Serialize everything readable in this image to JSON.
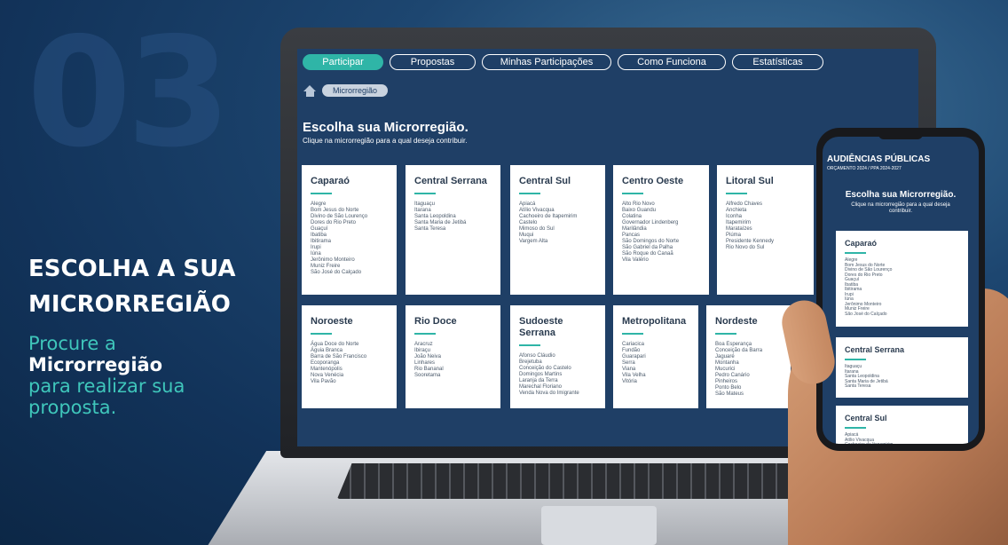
{
  "promo": {
    "number": "03",
    "headline_line1": "ESCOLHA A SUA",
    "headline_line2": "MICRORREGIÃO",
    "sub_part1": "Procure a",
    "sub_bold": "Microrregião",
    "sub_part2": "para realizar sua proposta."
  },
  "nav": {
    "tabs": [
      "Participar",
      "Propostas",
      "Minhas Participações",
      "Como Funciona",
      "Estatísticas"
    ],
    "active": "Participar"
  },
  "breadcrumb": {
    "current": "Microrregião"
  },
  "page": {
    "title": "Escolha sua Microrregião.",
    "subtitle": "Clique na microrregião para a qual deseja contribuir."
  },
  "regions": [
    {
      "name": "Caparaó",
      "cities": [
        "Alegre",
        "Bom Jesus do Norte",
        "Divino de São Lourenço",
        "Dores do Rio Preto",
        "Guaçuí",
        "Ibatiba",
        "Ibitirama",
        "Irupi",
        "Iúna",
        "Jerônimo Monteiro",
        "Muniz Freire",
        "São José do Calçado"
      ]
    },
    {
      "name": "Central Serrana",
      "cities": [
        "Itaguaçu",
        "Itarana",
        "Santa Leopoldina",
        "Santa Maria de Jetibá",
        "Santa Teresa"
      ]
    },
    {
      "name": "Central Sul",
      "cities": [
        "Apiacá",
        "Atílio Vivacqua",
        "Cachoeiro de Itapemirim",
        "Castelo",
        "Mimoso do Sul",
        "Muqui",
        "Vargem Alta"
      ]
    },
    {
      "name": "Centro Oeste",
      "cities": [
        "Alto Rio Novo",
        "Baixo Guandu",
        "Colatina",
        "Governador Lindenberg",
        "Marilândia",
        "Pancas",
        "São Domingos do Norte",
        "São Gabriel da Palha",
        "São Roque do Canaã",
        "Vila Valério"
      ]
    },
    {
      "name": "Litoral Sul",
      "cities": [
        "Alfredo Chaves",
        "Anchieta",
        "Iconha",
        "Itapemirim",
        "Marataízes",
        "Piúma",
        "Presidente Kennedy",
        "Rio Novo do Sul"
      ]
    },
    {
      "name": "Noroeste",
      "cities": [
        "Água Doce do Norte",
        "Águia Branca",
        "Barra de São Francisco",
        "Ecoporanga",
        "Mantenópolis",
        "Nova Venécia",
        "Vila Pavão"
      ]
    },
    {
      "name": "Rio Doce",
      "cities": [
        "Aracruz",
        "Ibiraçu",
        "João Neiva",
        "Linhares",
        "Rio Bananal",
        "Sooretama"
      ]
    },
    {
      "name": "Sudoeste Serrana",
      "cities": [
        "Afonso Cláudio",
        "Brejetuba",
        "Conceição do Castelo",
        "Domingos Martins",
        "Laranja da Terra",
        "Marechal Floriano",
        "Venda Nova do Imigrante"
      ]
    },
    {
      "name": "Metropolitana",
      "cities": [
        "Cariacica",
        "Fundão",
        "Guarapari",
        "Serra",
        "Viana",
        "Vila Velha",
        "Vitória"
      ]
    },
    {
      "name": "Nordeste",
      "cities": [
        "Boa Esperança",
        "Conceição da Barra",
        "Jaguaré",
        "Montanha",
        "Mucurici",
        "Pedro Canário",
        "Pinheiros",
        "Ponto Belo",
        "São Mateus"
      ]
    }
  ],
  "phone": {
    "brand_line1": "AUDIÊNCIAS PÚBLICAS",
    "brand_line2": "ORÇAMENTO 2024 / PPA 2024-2027",
    "title": "Escolha sua Microrregião.",
    "subtitle": "Clique na microrregião para a qual deseja contribuir.",
    "cards": [
      {
        "name": "Caparaó",
        "cities": [
          "Alegre",
          "Bom Jesus do Norte",
          "Divino de São Lourenço",
          "Dores do Rio Preto",
          "Guaçuí",
          "Ibatiba",
          "Ibitirama",
          "Irupi",
          "Iúna",
          "Jerônimo Monteiro",
          "Muniz Freire",
          "São José do Calçado"
        ]
      },
      {
        "name": "Central Serrana",
        "cities": [
          "Itaguaçu",
          "Itarana",
          "Santa Leopoldina",
          "Santa Maria de Jetibá",
          "Santa Teresa"
        ]
      },
      {
        "name": "Central Sul",
        "cities": [
          "Apiacá",
          "Atílio Vivacqua",
          "Cachoeiro de Itapemirim"
        ]
      }
    ]
  },
  "colors": {
    "accent": "#2fb5a7",
    "screen_bg": "#1f3f66",
    "teal_text": "#3fc6bb"
  }
}
